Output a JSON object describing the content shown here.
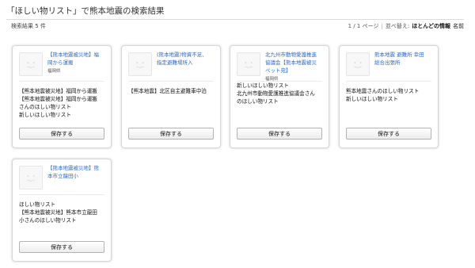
{
  "page": {
    "title": "「ほしい物リスト」で熊本地震の検索結果"
  },
  "results": {
    "count_label": "検索結果 5 件"
  },
  "pager": {
    "page_label": "1 / 1 ページ",
    "sort_prefix": "並べ替え:",
    "sort_active": "ほとんどの情報",
    "sort_option": "名前"
  },
  "cards": [
    {
      "title_lines": [
        "【熊本地震被災地】福",
        "岡から運搬"
      ],
      "location": "福岡県",
      "body_lines": [
        "【熊本地震被災地】福岡から運搬",
        "【熊本地震被災地】福岡から運搬",
        "さんのほしい物リスト",
        "新しいほしい物リスト"
      ],
      "button": "保存する"
    },
    {
      "title_lines": [
        "(熊本地震)物資不足、",
        "指定避難場所入"
      ],
      "location": "",
      "body_lines": [
        "【熊本地震】北区自主避難車中泊"
      ],
      "button": "保存する"
    },
    {
      "title_lines": [
        "北九州市動物愛護推進",
        "協議会【熊本地震被災",
        "ペット宛】"
      ],
      "location": "福岡県",
      "body_lines": [
        "新しいほしい物リスト",
        "北九州市動物愛護推進協議会さん",
        "のほしい物リスト"
      ],
      "button": "保存する"
    },
    {
      "title_lines": [
        "熊本地震 避難所 幸田",
        "総合出張所"
      ],
      "location": "",
      "body_lines": [
        "熊本地震さんのほしい物リスト",
        "新しいほしい物リスト"
      ],
      "button": "保存する"
    },
    {
      "title_lines": [
        "【熊本地震被災地】熊",
        "本市立龍田小"
      ],
      "location": "",
      "body_lines": [
        "ほしい物リスト",
        "【熊本地震被災地】熊本市立龍田",
        "小さんのほしい物リスト"
      ],
      "button": "保存する"
    }
  ]
}
